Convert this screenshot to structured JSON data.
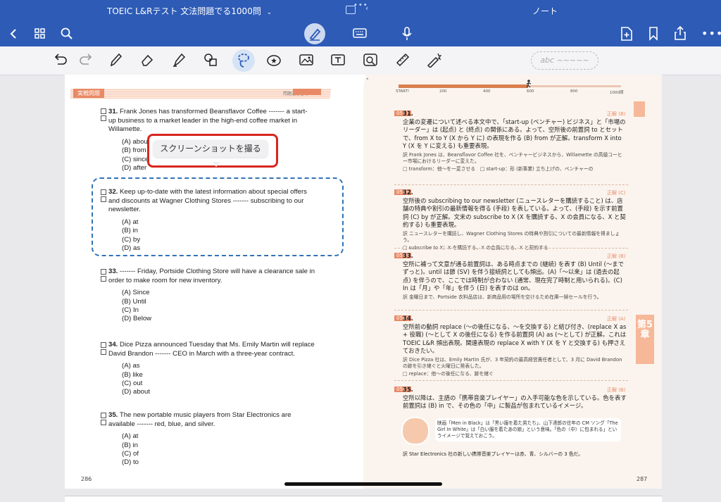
{
  "app": {
    "left_title": "TOEIC L&Rテスト 文法問題でる1000問",
    "right_title": "ノート"
  },
  "header": {
    "icons": [
      "back-icon",
      "grid-icon",
      "search-icon",
      "pen-mode-icon",
      "keyboard-icon",
      "microphone-icon",
      "add-page-icon",
      "bookmark-icon",
      "share-icon",
      "more-icon"
    ]
  },
  "toolbar": {
    "handwriting_placeholder": "abc ~~~~~",
    "tools": [
      "undo",
      "redo",
      "pen",
      "eraser",
      "highlighter",
      "shapes",
      "lasso",
      "sticker",
      "image",
      "text",
      "camera",
      "ruler",
      "laser"
    ]
  },
  "left_page": {
    "header_title": "実戦問題",
    "header_sub": "問題通し番号",
    "page_number": "286",
    "questions": [
      {
        "num": "31.",
        "text": "Frank Jones has transformed Beansflavor Coffee ------- a start-up business to a market leader in the high-end coffee market in Willamette.",
        "opts": [
          "(A) about",
          "(B) from",
          "(C) since",
          "(D) after"
        ]
      },
      {
        "num": "32.",
        "text": "Keep up-to-date with the latest information about special offers and discounts at Wagner Clothing Stores ------- subscribing to our newsletter.",
        "opts": [
          "(A) at",
          "(B) in",
          "(C) by",
          "(D) as"
        ]
      },
      {
        "num": "33.",
        "text": "------- Friday, Portside Clothing Store will have a clearance sale in order to make room for new inventory.",
        "opts": [
          "(A) Since",
          "(B) Until",
          "(C) In",
          "(D) Below"
        ]
      },
      {
        "num": "34.",
        "text": "Dice Pizza announced Tuesday that Ms. Emily Martin will replace David Brandon ------- CEO in March with a three-year contract.",
        "opts": [
          "(A) as",
          "(B) like",
          "(C) out",
          "(D) about"
        ]
      },
      {
        "num": "35.",
        "text": "The new portable music players from Star Electronics are available ------- red, blue, and silver.",
        "opts": [
          "(A) at",
          "(B) in",
          "(C) of",
          "(D) to"
        ]
      }
    ]
  },
  "tooltip": {
    "label": "スクリーンショットを撮る"
  },
  "right_page": {
    "page_number": "287",
    "chapter_tab": "第5章",
    "progress_labels": [
      "START!",
      "200",
      "400",
      "600",
      "800",
      "1000問"
    ],
    "answers": [
      {
        "badge": "0577",
        "num": "31.",
        "level": "正解 (B)",
        "body": "企業の変遷について述べる本文中で、「start-up (ベンチャー) ビジネス」と「市場のリーダー」は (起点) と (終点) の関係にある。よって、空所後の前置詞 to とセットで、from X to Y (X から Y に) の表現を作る (B) from が正解。transform X into Y (X を Y に変える) も重要表現。",
        "note": "訳 Frank Jones は、Beansflavor Coffee 社を、ベンチャービジネスから、Willamette の高級コーヒー市場におけるリーダーに変えた。",
        "vocab": "□ transform：他〜を一変させる　□ start-up：形 (新事業) 立ち上げの、ベンチャーの"
      },
      {
        "badge": "0578",
        "num": "32.",
        "level": "正解 (C)",
        "body": "空所後の subscribing to our newsletter (ニュースレターを購読すること) は、店舗の特典や割引の最新情報を得る (手段) を表している。よって、(手段) を示す前置詞 (C) by が正解。文末の subscribe to X (X を購読する、X の会員になる、X と契約する) も重要表現。",
        "note": "訳 ニュースレターを購読し、Wagner Clothing Stores の特典や割引についての最新情報を得ましょう。",
        "vocab": "□ subscribe to X：X を購読する、X の会員になる、X と契約する"
      },
      {
        "badge": "0579",
        "num": "33.",
        "level": "正解 (B)",
        "body": "空所に補って文意が通る前置詞は、ある時点までの (継続) を表す (B) Until (〜までずっと)。until は節 (SV) を伴う接続詞としても頻出。(A)「〜以来」は (過去の起点) を伴うので、ここでは時制が合わない (通常、現在完了時制と用いられる)。(C) In は「月」や「年」を伴う (日) を表すのは on。",
        "note": "訳 金曜日まで、Portside 衣料品店は、新商品用の場所を空けるため在庫一掃セールを行う。",
        "vocab": ""
      },
      {
        "badge": "0580",
        "num": "34.",
        "level": "正解 (A)",
        "body": "空所前の動詞 replace (〜の後任になる、〜を交換する) と結び付き、(replace X as + 役職) (〜として X の後任になる) を作る前置詞 (A) as (〜として) が正解。これは TOEIC L&R 頻出表現。関連表現の replace X with Y (X を Y と交換する) も押さえておきたい。",
        "note": "訳 Dice Pizza 社は、Emily Martin 氏が、3 年契約の最高経営責任者として、3 月に David Brandon の跡を引き継ぐと火曜日に発表した。",
        "vocab": "□ replace：他〜の後任になる、跡を継ぐ"
      },
      {
        "badge": "0581",
        "num": "35.",
        "level": "正解 (B)",
        "body": "空所以降は、主語の「携帯音楽プレイヤー」の入手可能な色を示している。色を表す前置詞は (B) in で、その色の「中」に製品が包まれているイメージ。",
        "note": "映画「Men in Black」は「黒い服を着た男たち」、山下達郎の往年の CM ソング「The Girl In White」は「白い服を着たあの娘」という意味。「色の〈中〉に包まれる」というイメージで覚えておこう。",
        "vocab": "訳 Star Electronics 社の新しい携帯音楽プレイヤーは赤、青、シルバーの 3 色だ。"
      }
    ]
  }
}
